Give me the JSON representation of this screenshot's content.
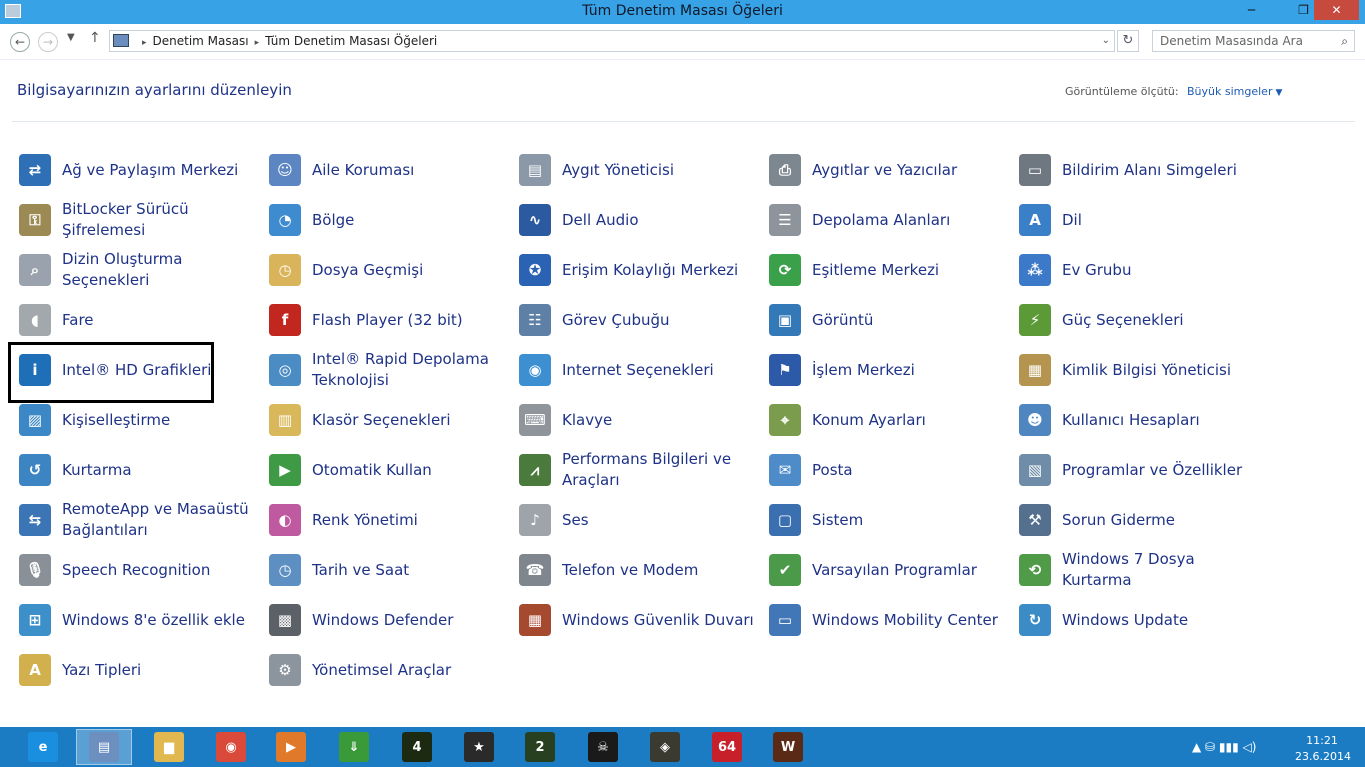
{
  "window": {
    "title": "Tüm Denetim Masası Öğeleri",
    "minimize": "─",
    "maximize": "❐",
    "close": "✕"
  },
  "nav": {
    "back": "←",
    "forward": "→",
    "recent": "▼",
    "up": "↑",
    "refresh": "↻"
  },
  "address": {
    "crumbs": [
      "Denetim Masası",
      "Tüm Denetim Masası Öğeleri"
    ],
    "separator": "▸",
    "dropdown": "⌄"
  },
  "search": {
    "placeholder": "Denetim Masasında Ara",
    "icon": "⌕"
  },
  "header": {
    "title": "Bilgisayarınızın ayarlarını düzenleyin",
    "view_by_label": "Görüntüleme ölçütü:",
    "view_by_value": "Büyük simgeler",
    "view_caret": "▼"
  },
  "items": [
    {
      "label": "Ağ ve Paylaşım Merkezi",
      "icon": "network-icon",
      "color": "#2f6fb5",
      "glyph": "⇄"
    },
    {
      "label": "Aile Koruması",
      "icon": "family-icon",
      "color": "#5b86c2",
      "glyph": "☺"
    },
    {
      "label": "Aygıt Yöneticisi",
      "icon": "device-manager-icon",
      "color": "#8a98a8",
      "glyph": "▤"
    },
    {
      "label": "Aygıtlar ve Yazıcılar",
      "icon": "printer-icon",
      "color": "#7d8790",
      "glyph": "⎙"
    },
    {
      "label": "Bildirim Alanı Simgeleri",
      "icon": "notification-icon",
      "color": "#6f7780",
      "glyph": "▭"
    },
    {
      "label": "BitLocker Sürücü Şifrelemesi",
      "icon": "bitlocker-icon",
      "color": "#9c8a55",
      "glyph": "⚿"
    },
    {
      "label": "Bölge",
      "icon": "region-icon",
      "color": "#3f8bd0",
      "glyph": "◔"
    },
    {
      "label": "Dell Audio",
      "icon": "dell-audio-icon",
      "color": "#2c5aa0",
      "glyph": "∿"
    },
    {
      "label": "Depolama Alanları",
      "icon": "storage-icon",
      "color": "#8d949b",
      "glyph": "☰"
    },
    {
      "label": "Dil",
      "icon": "language-icon",
      "color": "#3a80c8",
      "glyph": "A"
    },
    {
      "label": "Dizin Oluşturma Seçenekleri",
      "icon": "indexing-icon",
      "color": "#9aa3ad",
      "glyph": "⌕"
    },
    {
      "label": "Dosya Geçmişi",
      "icon": "file-history-icon",
      "color": "#d9b45a",
      "glyph": "◷"
    },
    {
      "label": "Erişim Kolaylığı Merkezi",
      "icon": "ease-of-access-icon",
      "color": "#2b63b4",
      "glyph": "✪"
    },
    {
      "label": "Eşitleme Merkezi",
      "icon": "sync-icon",
      "color": "#3aa14a",
      "glyph": "⟳"
    },
    {
      "label": "Ev Grubu",
      "icon": "homegroup-icon",
      "color": "#3d79c9",
      "glyph": "⁂"
    },
    {
      "label": "Fare",
      "icon": "mouse-icon",
      "color": "#a3a8ad",
      "glyph": "◖"
    },
    {
      "label": "Flash Player (32 bit)",
      "icon": "flash-icon",
      "color": "#c1261f",
      "glyph": "f"
    },
    {
      "label": "Görev Çubuğu",
      "icon": "taskbar-icon",
      "color": "#5e7fa6",
      "glyph": "☷"
    },
    {
      "label": "Görüntü",
      "icon": "display-icon",
      "color": "#3479b7",
      "glyph": "▣"
    },
    {
      "label": "Güç Seçenekleri",
      "icon": "power-icon",
      "color": "#5c9a37",
      "glyph": "⚡"
    },
    {
      "label": "Intel® HD Grafikleri",
      "icon": "intel-graphics-icon",
      "color": "#1f6fb8",
      "glyph": "i"
    },
    {
      "label": "Intel® Rapid Depolama Teknolojisi",
      "icon": "intel-rapid-storage-icon",
      "color": "#4b8cc4",
      "glyph": "◎"
    },
    {
      "label": "Internet Seçenekleri",
      "icon": "internet-options-icon",
      "color": "#3c8fd0",
      "glyph": "◉"
    },
    {
      "label": "İşlem Merkezi",
      "icon": "action-center-icon",
      "color": "#2d5aa8",
      "glyph": "⚑"
    },
    {
      "label": "Kimlik Bilgisi Yöneticisi",
      "icon": "credential-icon",
      "color": "#b59450",
      "glyph": "▦"
    },
    {
      "label": "Kişiselleştirme",
      "icon": "personalization-icon",
      "color": "#3c88c6",
      "glyph": "▨"
    },
    {
      "label": "Klasör Seçenekleri",
      "icon": "folder-options-icon",
      "color": "#d8b85a",
      "glyph": "▥"
    },
    {
      "label": "Klavye",
      "icon": "keyboard-icon",
      "color": "#8f959b",
      "glyph": "⌨"
    },
    {
      "label": "Konum Ayarları",
      "icon": "location-icon",
      "color": "#7b9c4d",
      "glyph": "⌖"
    },
    {
      "label": "Kullanıcı Hesapları",
      "icon": "user-accounts-icon",
      "color": "#4f86c0",
      "glyph": "☻"
    },
    {
      "label": "Kurtarma",
      "icon": "recovery-icon",
      "color": "#3d84c3",
      "glyph": "↺"
    },
    {
      "label": "Otomatik Kullan",
      "icon": "autoplay-icon",
      "color": "#3e9a45",
      "glyph": "▶"
    },
    {
      "label": "Performans Bilgileri ve Araçları",
      "icon": "performance-icon",
      "color": "#4a7a3c",
      "glyph": "⩘"
    },
    {
      "label": "Posta",
      "icon": "mail-icon",
      "color": "#4d8cc8",
      "glyph": "✉"
    },
    {
      "label": "Programlar ve Özellikler",
      "icon": "programs-icon",
      "color": "#6f8da8",
      "glyph": "▧"
    },
    {
      "label": "RemoteApp ve Masaüstü Bağlantıları",
      "icon": "remoteapp-icon",
      "color": "#3b75b5",
      "glyph": "⇆"
    },
    {
      "label": "Renk Yönetimi",
      "icon": "color-management-icon",
      "color": "#c05aa0",
      "glyph": "◐"
    },
    {
      "label": "Ses",
      "icon": "sound-icon",
      "color": "#9ea4aa",
      "glyph": "♪"
    },
    {
      "label": "Sistem",
      "icon": "system-icon",
      "color": "#3a6fb0",
      "glyph": "▢"
    },
    {
      "label": "Sorun Giderme",
      "icon": "troubleshooting-icon",
      "color": "#556f8f",
      "glyph": "⚒"
    },
    {
      "label": "Speech Recognition",
      "icon": "microphone-icon",
      "color": "#8a9097",
      "glyph": "🎙"
    },
    {
      "label": "Tarih ve Saat",
      "icon": "date-time-icon",
      "color": "#5e8fc2",
      "glyph": "◷"
    },
    {
      "label": "Telefon ve Modem",
      "icon": "phone-icon",
      "color": "#7f868d",
      "glyph": "☎"
    },
    {
      "label": "Varsayılan Programlar",
      "icon": "default-programs-icon",
      "color": "#4a9a4a",
      "glyph": "✔"
    },
    {
      "label": "Windows 7 Dosya Kurtarma",
      "icon": "windows7-recovery-icon",
      "color": "#4f9b47",
      "glyph": "⟲"
    },
    {
      "label": "Windows 8'e özellik ekle",
      "icon": "add-features-icon",
      "color": "#3d8fc9",
      "glyph": "⊞"
    },
    {
      "label": "Windows Defender",
      "icon": "defender-icon",
      "color": "#5b6166",
      "glyph": "▩"
    },
    {
      "label": "Windows Güvenlik Duvarı",
      "icon": "firewall-icon",
      "color": "#a54a2f",
      "glyph": "▦"
    },
    {
      "label": "Windows Mobility Center",
      "icon": "mobility-icon",
      "color": "#4177b6",
      "glyph": "▭"
    },
    {
      "label": "Windows Update",
      "icon": "windows-update-icon",
      "color": "#3b8bc7",
      "glyph": "↻"
    },
    {
      "label": "Yazı Tipleri",
      "icon": "fonts-icon",
      "color": "#d2b04e",
      "glyph": "A"
    },
    {
      "label": "Yönetimsel Araçlar",
      "icon": "admin-tools-icon",
      "color": "#8c959e",
      "glyph": "⚙"
    }
  ],
  "taskbar": {
    "apps": [
      {
        "name": "internet-explorer-icon",
        "glyph": "e",
        "color": "#1a8fe0",
        "active": false
      },
      {
        "name": "control-panel-icon",
        "glyph": "▤",
        "color": "#6c8fbf",
        "active": true
      },
      {
        "name": "file-explorer-icon",
        "glyph": "▆",
        "color": "#e0b84f",
        "active": false
      },
      {
        "name": "chrome-icon",
        "glyph": "◉",
        "color": "#d94a3a",
        "active": false
      },
      {
        "name": "media-player-icon",
        "glyph": "▶",
        "color": "#e07a2a",
        "active": false
      },
      {
        "name": "download-manager-icon",
        "glyph": "⇓",
        "color": "#3a9a3a",
        "active": false
      },
      {
        "name": "game1-icon",
        "glyph": "4",
        "color": "#1d2a12",
        "active": false
      },
      {
        "name": "game2-icon",
        "glyph": "★",
        "color": "#2a2a2a",
        "active": false
      },
      {
        "name": "game3-icon",
        "glyph": "2",
        "color": "#27401f",
        "active": false
      },
      {
        "name": "game4-icon",
        "glyph": "☠",
        "color": "#1a1a1a",
        "active": false
      },
      {
        "name": "game5-icon",
        "glyph": "◈",
        "color": "#3a3a30",
        "active": false
      },
      {
        "name": "game6-icon",
        "glyph": "64",
        "color": "#c8202a",
        "active": false
      },
      {
        "name": "game7-icon",
        "glyph": "W",
        "color": "#5a2a16",
        "active": false
      }
    ]
  },
  "tray": {
    "icons": "▲  ⛁  ▮▮▮  ◁)",
    "time": "11:21",
    "date": "23.6.2014"
  }
}
